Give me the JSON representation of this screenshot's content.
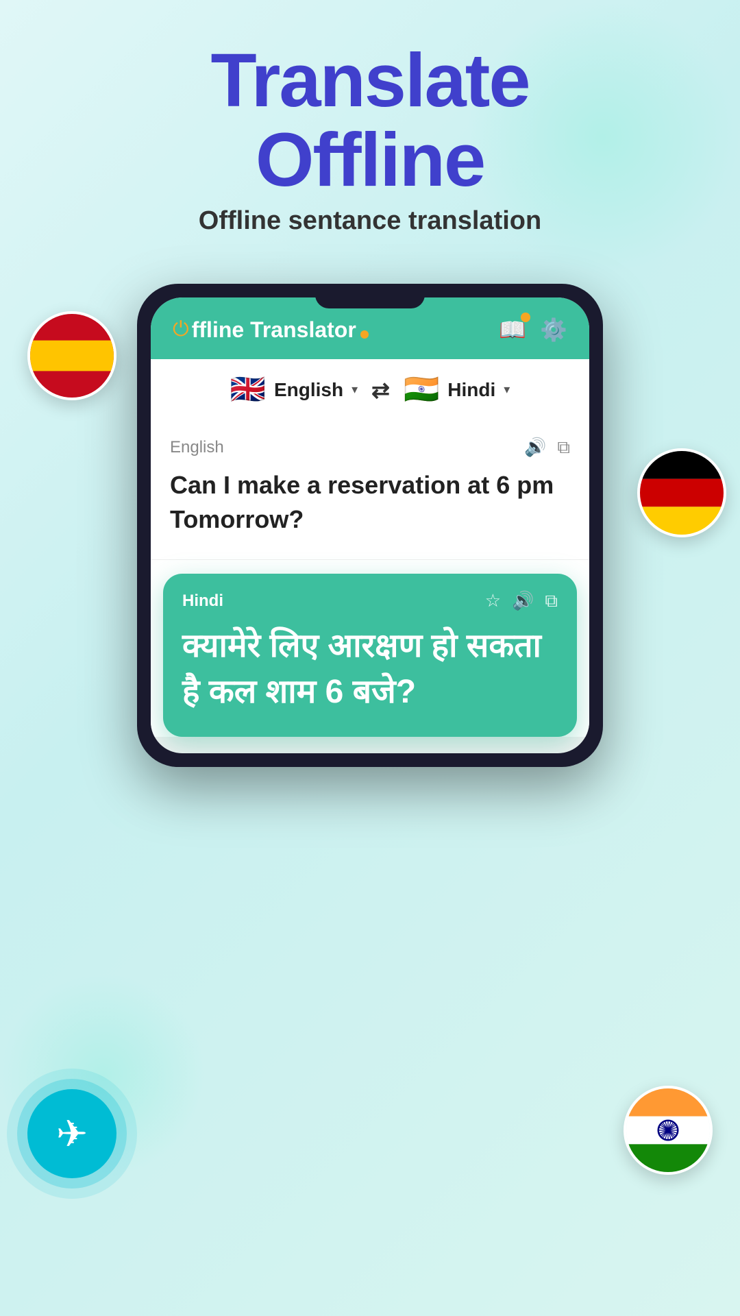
{
  "hero": {
    "title_line1": "Translate",
    "title_line2": "Offline",
    "subtitle": "Offline sentance translation"
  },
  "app": {
    "logo_text": "ffline Translator",
    "logo_power_symbol": "⏻"
  },
  "lang_bar": {
    "source_lang": "English",
    "target_lang": "Hindi",
    "source_flag": "🇬🇧",
    "target_flag": "🇮🇳"
  },
  "input_card": {
    "label": "English",
    "text": "Can I make a reservation at 6 pm Tomorrow?"
  },
  "translation_card": {
    "label": "Hindi",
    "text": "क्यामेरे लिए आरक्षण हो सकता है कल शाम 6 बजे?"
  },
  "flags": {
    "spain": "🇪🇸",
    "germany": "🇩🇪",
    "india": "🇮🇳"
  },
  "colors": {
    "title": "#4040cc",
    "app_header_bg": "#3dbf9e",
    "translation_card_bg": "#3dbf9e",
    "airplane_btn_bg": "#00bcd4",
    "logo_accent": "#f5a623"
  }
}
